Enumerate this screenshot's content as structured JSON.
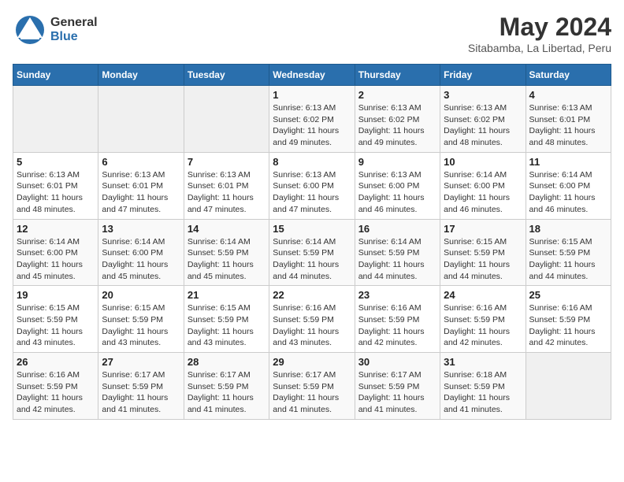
{
  "logo": {
    "text_general": "General",
    "text_blue": "Blue"
  },
  "title": {
    "month_year": "May 2024",
    "location": "Sitabamba, La Libertad, Peru"
  },
  "days_of_week": [
    "Sunday",
    "Monday",
    "Tuesday",
    "Wednesday",
    "Thursday",
    "Friday",
    "Saturday"
  ],
  "weeks": [
    [
      {
        "day": "",
        "info": ""
      },
      {
        "day": "",
        "info": ""
      },
      {
        "day": "",
        "info": ""
      },
      {
        "day": "1",
        "info": "Sunrise: 6:13 AM\nSunset: 6:02 PM\nDaylight: 11 hours and 49 minutes."
      },
      {
        "day": "2",
        "info": "Sunrise: 6:13 AM\nSunset: 6:02 PM\nDaylight: 11 hours and 49 minutes."
      },
      {
        "day": "3",
        "info": "Sunrise: 6:13 AM\nSunset: 6:02 PM\nDaylight: 11 hours and 48 minutes."
      },
      {
        "day": "4",
        "info": "Sunrise: 6:13 AM\nSunset: 6:01 PM\nDaylight: 11 hours and 48 minutes."
      }
    ],
    [
      {
        "day": "5",
        "info": "Sunrise: 6:13 AM\nSunset: 6:01 PM\nDaylight: 11 hours and 48 minutes."
      },
      {
        "day": "6",
        "info": "Sunrise: 6:13 AM\nSunset: 6:01 PM\nDaylight: 11 hours and 47 minutes."
      },
      {
        "day": "7",
        "info": "Sunrise: 6:13 AM\nSunset: 6:01 PM\nDaylight: 11 hours and 47 minutes."
      },
      {
        "day": "8",
        "info": "Sunrise: 6:13 AM\nSunset: 6:00 PM\nDaylight: 11 hours and 47 minutes."
      },
      {
        "day": "9",
        "info": "Sunrise: 6:13 AM\nSunset: 6:00 PM\nDaylight: 11 hours and 46 minutes."
      },
      {
        "day": "10",
        "info": "Sunrise: 6:14 AM\nSunset: 6:00 PM\nDaylight: 11 hours and 46 minutes."
      },
      {
        "day": "11",
        "info": "Sunrise: 6:14 AM\nSunset: 6:00 PM\nDaylight: 11 hours and 46 minutes."
      }
    ],
    [
      {
        "day": "12",
        "info": "Sunrise: 6:14 AM\nSunset: 6:00 PM\nDaylight: 11 hours and 45 minutes."
      },
      {
        "day": "13",
        "info": "Sunrise: 6:14 AM\nSunset: 6:00 PM\nDaylight: 11 hours and 45 minutes."
      },
      {
        "day": "14",
        "info": "Sunrise: 6:14 AM\nSunset: 5:59 PM\nDaylight: 11 hours and 45 minutes."
      },
      {
        "day": "15",
        "info": "Sunrise: 6:14 AM\nSunset: 5:59 PM\nDaylight: 11 hours and 44 minutes."
      },
      {
        "day": "16",
        "info": "Sunrise: 6:14 AM\nSunset: 5:59 PM\nDaylight: 11 hours and 44 minutes."
      },
      {
        "day": "17",
        "info": "Sunrise: 6:15 AM\nSunset: 5:59 PM\nDaylight: 11 hours and 44 minutes."
      },
      {
        "day": "18",
        "info": "Sunrise: 6:15 AM\nSunset: 5:59 PM\nDaylight: 11 hours and 44 minutes."
      }
    ],
    [
      {
        "day": "19",
        "info": "Sunrise: 6:15 AM\nSunset: 5:59 PM\nDaylight: 11 hours and 43 minutes."
      },
      {
        "day": "20",
        "info": "Sunrise: 6:15 AM\nSunset: 5:59 PM\nDaylight: 11 hours and 43 minutes."
      },
      {
        "day": "21",
        "info": "Sunrise: 6:15 AM\nSunset: 5:59 PM\nDaylight: 11 hours and 43 minutes."
      },
      {
        "day": "22",
        "info": "Sunrise: 6:16 AM\nSunset: 5:59 PM\nDaylight: 11 hours and 43 minutes."
      },
      {
        "day": "23",
        "info": "Sunrise: 6:16 AM\nSunset: 5:59 PM\nDaylight: 11 hours and 42 minutes."
      },
      {
        "day": "24",
        "info": "Sunrise: 6:16 AM\nSunset: 5:59 PM\nDaylight: 11 hours and 42 minutes."
      },
      {
        "day": "25",
        "info": "Sunrise: 6:16 AM\nSunset: 5:59 PM\nDaylight: 11 hours and 42 minutes."
      }
    ],
    [
      {
        "day": "26",
        "info": "Sunrise: 6:16 AM\nSunset: 5:59 PM\nDaylight: 11 hours and 42 minutes."
      },
      {
        "day": "27",
        "info": "Sunrise: 6:17 AM\nSunset: 5:59 PM\nDaylight: 11 hours and 41 minutes."
      },
      {
        "day": "28",
        "info": "Sunrise: 6:17 AM\nSunset: 5:59 PM\nDaylight: 11 hours and 41 minutes."
      },
      {
        "day": "29",
        "info": "Sunrise: 6:17 AM\nSunset: 5:59 PM\nDaylight: 11 hours and 41 minutes."
      },
      {
        "day": "30",
        "info": "Sunrise: 6:17 AM\nSunset: 5:59 PM\nDaylight: 11 hours and 41 minutes."
      },
      {
        "day": "31",
        "info": "Sunrise: 6:18 AM\nSunset: 5:59 PM\nDaylight: 11 hours and 41 minutes."
      },
      {
        "day": "",
        "info": ""
      }
    ]
  ]
}
